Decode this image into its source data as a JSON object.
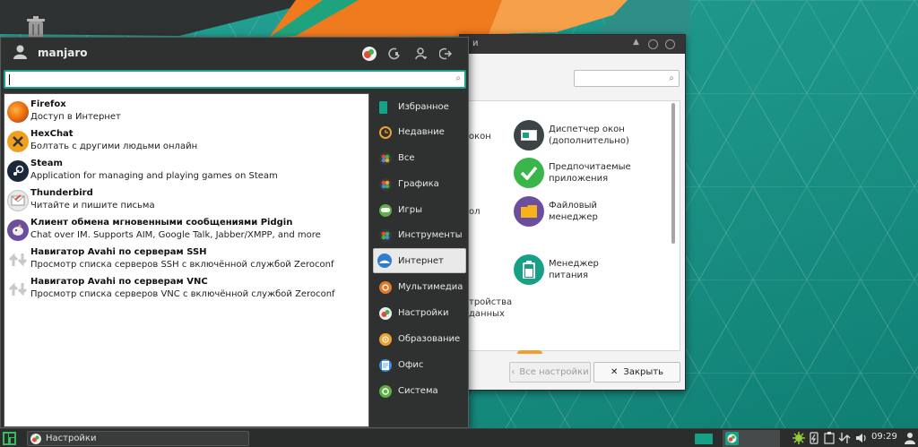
{
  "menu": {
    "username": "manjaro",
    "search": {
      "value": "",
      "placeholder": ""
    },
    "apps": [
      {
        "name": "Firefox",
        "desc": "Доступ в Интернет",
        "icon": "firefox-icon"
      },
      {
        "name": "HexChat",
        "desc": "Болтать с другими людьми онлайн",
        "icon": "hexchat-icon"
      },
      {
        "name": "Steam",
        "desc": "Application for managing and playing games on Steam",
        "icon": "steam-icon"
      },
      {
        "name": "Thunderbird",
        "desc": "Читайте и пишите письма",
        "icon": "thunderbird-icon"
      },
      {
        "name": "Клиент обмена мгновенными сообщениями Pidgin",
        "desc": "Chat over IM.  Supports AIM, Google Talk, Jabber/XMPP, and more",
        "icon": "pidgin-icon"
      },
      {
        "name": "Навигатор Avahi по серверам SSH",
        "desc": "Просмотр списка серверов SSH с включённой службой Zeroconf",
        "icon": "avahi-icon"
      },
      {
        "name": "Навигатор Avahi по серверам VNC",
        "desc": "Просмотр списка серверов VNC с включённой службой Zeroconf",
        "icon": "avahi-icon"
      }
    ],
    "categories": [
      {
        "label": "Избранное",
        "icon": "bookmark-icon",
        "color": "#16a085"
      },
      {
        "label": "Недавние",
        "icon": "clock-icon",
        "color": "#f0a030"
      },
      {
        "label": "Все",
        "icon": "all-apps-icon",
        "color": "#3a3a3a"
      },
      {
        "label": "Графика",
        "icon": "graphics-icon",
        "color": "#3a3a3a"
      },
      {
        "label": "Игры",
        "icon": "games-icon",
        "color": "#5db043"
      },
      {
        "label": "Инструменты",
        "icon": "tools-icon",
        "color": "#3a3a3a"
      },
      {
        "label": "Интернет",
        "icon": "internet-icon",
        "color": "#2f7dd1"
      },
      {
        "label": "Мультимедиа",
        "icon": "multimedia-icon",
        "color": "#e07a2a"
      },
      {
        "label": "Настройки",
        "icon": "settings-icon",
        "color": "#e44a3a"
      },
      {
        "label": "Образование",
        "icon": "education-icon",
        "color": "#f0a030"
      },
      {
        "label": "Офис",
        "icon": "office-icon",
        "color": "#3b8ee0"
      },
      {
        "label": "Система",
        "icon": "system-icon",
        "color": "#5db043"
      }
    ],
    "active_category": "Интернет"
  },
  "settings_window": {
    "title_partial": "и",
    "partial_labels": [
      "окон",
      "ол",
      "тройства",
      "данных"
    ],
    "items": [
      {
        "label": "Диспетчер окон (дополнительно)",
        "icon": "window-manager-icon",
        "color": "#3d4446"
      },
      {
        "label": "Предпочитаемые приложения",
        "icon": "check-icon",
        "color": "#3ab54a"
      },
      {
        "label": "Файловый менеджер",
        "icon": "folder-icon",
        "color": "#6b4f9e"
      },
      {
        "label": "Менеджер питания",
        "icon": "battery-icon",
        "color": "#16a085"
      }
    ],
    "back_label": "Все настройки",
    "close_label": "Закрыть"
  },
  "taskbar": {
    "task_label": "Настройки",
    "clock": "09:29"
  },
  "colors": {
    "accent": "#16a085",
    "panel": "#2f3130",
    "desktop": "#1d9a8c"
  }
}
